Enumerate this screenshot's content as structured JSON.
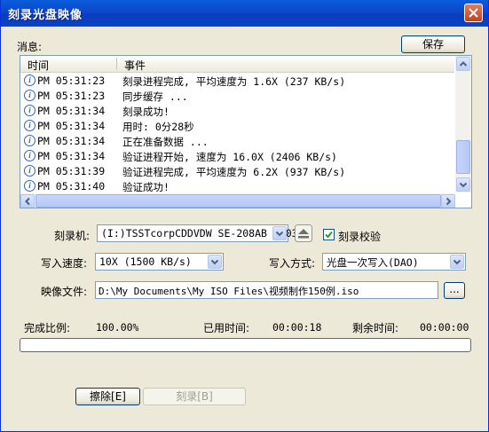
{
  "window": {
    "title": "刻录光盘映像"
  },
  "messages": {
    "label": "消息:",
    "save_button": "保存",
    "columns": [
      "时间",
      "事件"
    ],
    "rows": [
      {
        "time": "PM 05:31:23",
        "event": "刻录进程完成, 平均速度为 1.6X (237 KB/s)"
      },
      {
        "time": "PM 05:31:23",
        "event": "同步缓存 ..."
      },
      {
        "time": "PM 05:31:34",
        "event": "刻录成功!"
      },
      {
        "time": "PM 05:31:34",
        "event": "用时: 0分28秒"
      },
      {
        "time": "PM 05:31:34",
        "event": "正在准备数据 ..."
      },
      {
        "time": "PM 05:31:34",
        "event": "验证进程开始, 速度为 16.0X (2406 KB/s)"
      },
      {
        "time": "PM 05:31:39",
        "event": "验证进程完成, 平均速度为 6.2X (937 KB/s)"
      },
      {
        "time": "PM 05:31:40",
        "event": "验证成功!"
      }
    ]
  },
  "form": {
    "burner_label": "刻录机:",
    "burner_value": "(I:)TSSTcorpCDDVDW SE-208AB TS03",
    "verify_label": "刻录校验",
    "verify_checked": true,
    "speed_label": "写入速度:",
    "speed_value": "10X (1500 KB/s)",
    "mode_label": "写入方式:",
    "mode_value": "光盘一次写入(DAO)",
    "image_label": "映像文件:",
    "image_value": "D:\\My Documents\\My ISO Files\\视频制作150例.iso",
    "browse_label": "..."
  },
  "status": {
    "complete_label": "完成比例:",
    "complete_value": "100.00%",
    "elapsed_label": "已用时间:",
    "elapsed_value": "00:00:18",
    "remaining_label": "剩余时间:",
    "remaining_value": "00:00:00",
    "progress_fraction": 0.0
  },
  "buttons": {
    "erase": "擦除[E]",
    "burn": "刻录[B]"
  },
  "colors": {
    "title_bar": "#0a4fd1",
    "dialog_bg": "#ece9d8",
    "info_icon": "#2b62d9"
  }
}
